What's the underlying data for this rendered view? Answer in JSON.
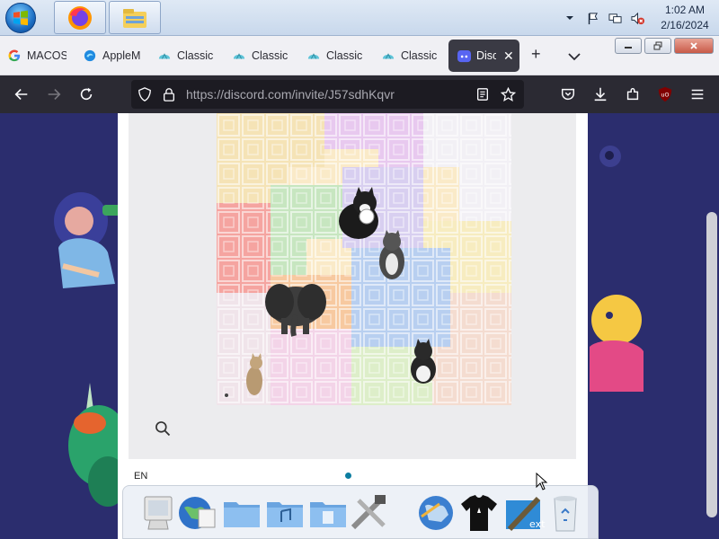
{
  "taskbar": {
    "clock_time": "1:02 AM",
    "clock_date": "2/16/2024",
    "tray_icons": [
      "chevron-up-icon",
      "flag-icon",
      "network-icon",
      "volume-muted-icon"
    ]
  },
  "browser": {
    "tabs": [
      {
        "label": "MACOS",
        "icon": "google-icon"
      },
      {
        "label": "AppleM",
        "icon": "edge-icon"
      },
      {
        "label": "Classic",
        "icon": "shell-icon"
      },
      {
        "label": "Classic",
        "icon": "shell-icon"
      },
      {
        "label": "Classic",
        "icon": "shell-icon"
      },
      {
        "label": "Classic",
        "icon": "shell-icon"
      },
      {
        "label": "Discord",
        "icon": "discord-icon",
        "active": true
      }
    ],
    "url": "https://discord.com/invite/J57sdhKqvr"
  },
  "captcha": {
    "language": "EN",
    "animals": [
      "cat",
      "cat",
      "elephant",
      "cat",
      "cat"
    ]
  },
  "dock": {
    "items": [
      "monitor-icon",
      "globe-icon",
      "folder-icon",
      "music-folder-icon",
      "documents-folder-icon",
      "utilities-icon",
      "internet-globe-icon",
      "tshirt-icon",
      "xcode-icon",
      "trash-icon"
    ]
  },
  "colors": {
    "page_background": "#2b2d6e",
    "active_tab": "#3a3a44",
    "navbar": "#2b2a33",
    "accent_dot": "#0c7da0"
  }
}
